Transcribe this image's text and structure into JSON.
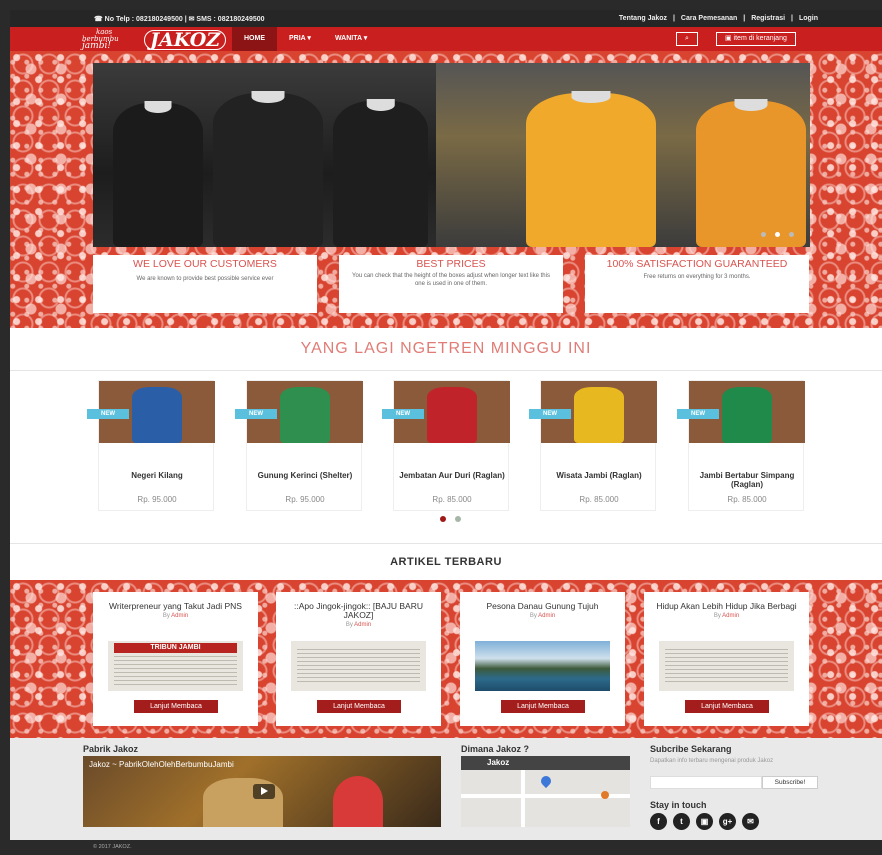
{
  "topbar": {
    "contact": "☎ No Telp : 082180249500 | ✉ SMS : 082180249500",
    "links": [
      "Tentang Jakoz",
      "|",
      "Cara Pemesanan",
      "|",
      "Registrasi",
      "|",
      "Login"
    ]
  },
  "logo": {
    "tagline1": "kaos",
    "tagline2": "berbumbu",
    "tagline3": "jambi!",
    "brand": "JAKOZ"
  },
  "nav": {
    "items": [
      "HOME",
      "PRIA ▾",
      "WANITA ▾"
    ],
    "search_icon": "⌕",
    "cart_label": "▣ item di keranjang"
  },
  "slider": {
    "dots": 3,
    "active_dot": 1
  },
  "features": [
    {
      "title": "WE LOVE OUR CUSTOMERS",
      "text": "We are known to provide best possible service ever"
    },
    {
      "title": "BEST PRICES",
      "text": "You can check that the height of the boxes adjust when longer text like this one is used in one of them."
    },
    {
      "title": "100% SATISFACTION GUARANTEED",
      "text": "Free returns on everything for 3 months."
    }
  ],
  "trending": {
    "title": "YANG LAGI NGETREN MINGGU INI",
    "badge": "NEW",
    "products": [
      {
        "name": "Negeri Kilang",
        "price": "Rp. 95.000",
        "color": "#2a5fa8"
      },
      {
        "name": "Gunung Kerinci (Shelter)",
        "price": "Rp. 95.000",
        "color": "#2e8f4e"
      },
      {
        "name": "Jembatan Aur Duri (Raglan)",
        "price": "Rp. 85.000",
        "color": "#c0242a"
      },
      {
        "name": "Wisata Jambi (Raglan)",
        "price": "Rp. 85.000",
        "color": "#e8b820"
      },
      {
        "name": "Jambi Bertabur Simpang (Raglan)",
        "price": "Rp. 85.000",
        "color": "#1f8a4a"
      }
    ]
  },
  "articles": {
    "title": "ARTIKEL TERBARU",
    "by_label": "By",
    "author": "Admin",
    "button": "Lanjut Membaca",
    "items": [
      {
        "title": "Writerpreneur yang Takut Jadi PNS",
        "thumb_text": "TRIBUN JAMBI"
      },
      {
        "title": "::Apo Jingok-jingok:: [BAJU BARU JAKOZ]",
        "thumb_text": ""
      },
      {
        "title": "Pesona Danau Gunung Tujuh",
        "thumb_text": ""
      },
      {
        "title": "Hidup Akan Lebih Hidup Jika Berbagi",
        "thumb_text": ""
      }
    ]
  },
  "footer": {
    "col1_title": "Pabrik Jakoz",
    "video_title": "Jakoz ~ PabrikOlehOlehBerbumbuJambi",
    "col2_title": "Dimana Jakoz ?",
    "map_title": "Jakoz",
    "col3_title": "Subcribe Sekarang",
    "subscribe_desc": "Dapatkan info terbaru mengenai produk Jakoz",
    "subscribe_button": "Subscribe!",
    "social_title": "Stay in touch",
    "socials": [
      "f",
      "t",
      "▣",
      "g+",
      "✉"
    ]
  },
  "copyright": "© 2017 JAKOZ."
}
